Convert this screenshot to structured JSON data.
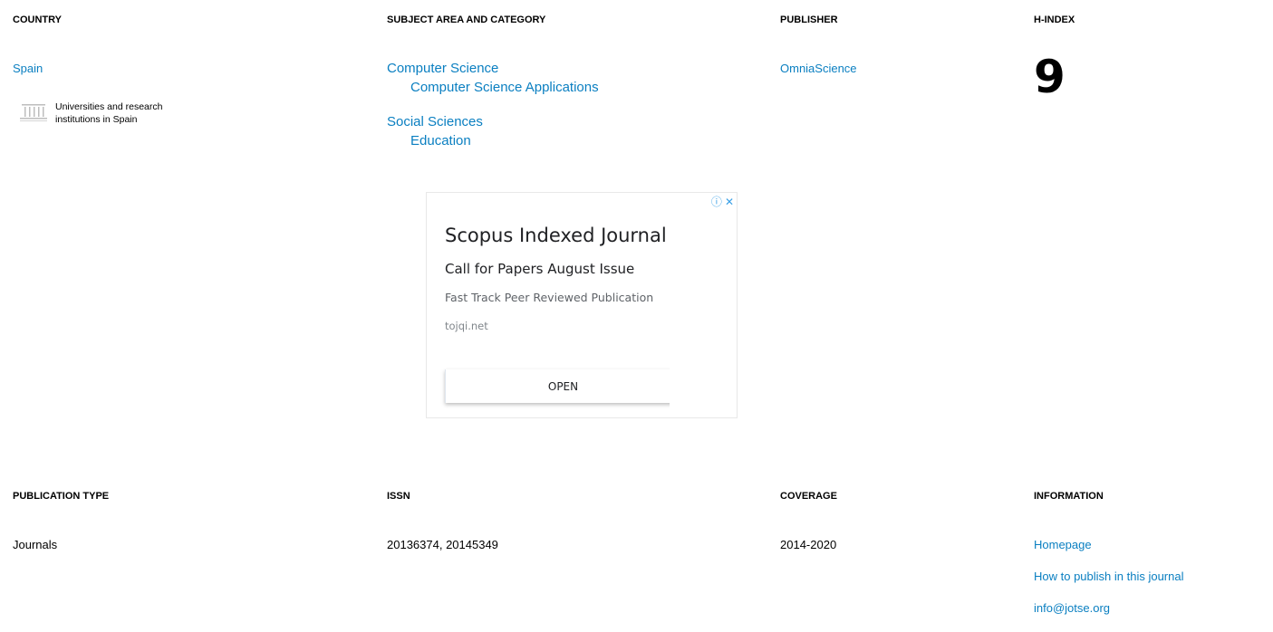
{
  "top": {
    "country": {
      "header": "COUNTRY",
      "value": "Spain",
      "institutions_text": "Universities and research institutions in Spain"
    },
    "subject": {
      "header": "SUBJECT AREA AND CATEGORY",
      "areas": [
        {
          "area": "Computer Science",
          "category": "Computer Science Applications"
        },
        {
          "area": "Social Sciences",
          "category": "Education"
        }
      ]
    },
    "publisher": {
      "header": "PUBLISHER",
      "value": "OmniaScience"
    },
    "hindex": {
      "header": "H-INDEX",
      "value": "9"
    }
  },
  "ad": {
    "title": "Scopus Indexed Journal",
    "subtitle": "Call for Papers August Issue",
    "description": "Fast Track Peer Reviewed Publication",
    "url": "tojqi.net",
    "button": "OPEN",
    "info_icon": "info-icon",
    "close_icon": "close-icon"
  },
  "bottom": {
    "publication_type": {
      "header": "PUBLICATION TYPE",
      "value": "Journals"
    },
    "issn": {
      "header": "ISSN",
      "value": "20136374, 20145349"
    },
    "coverage": {
      "header": "COVERAGE",
      "value": "2014-2020"
    },
    "information": {
      "header": "INFORMATION",
      "links": [
        "Homepage",
        "How to publish in this journal",
        "info@jotse.org"
      ]
    }
  },
  "colors": {
    "link": "#0a7fc1",
    "text": "#000000"
  }
}
